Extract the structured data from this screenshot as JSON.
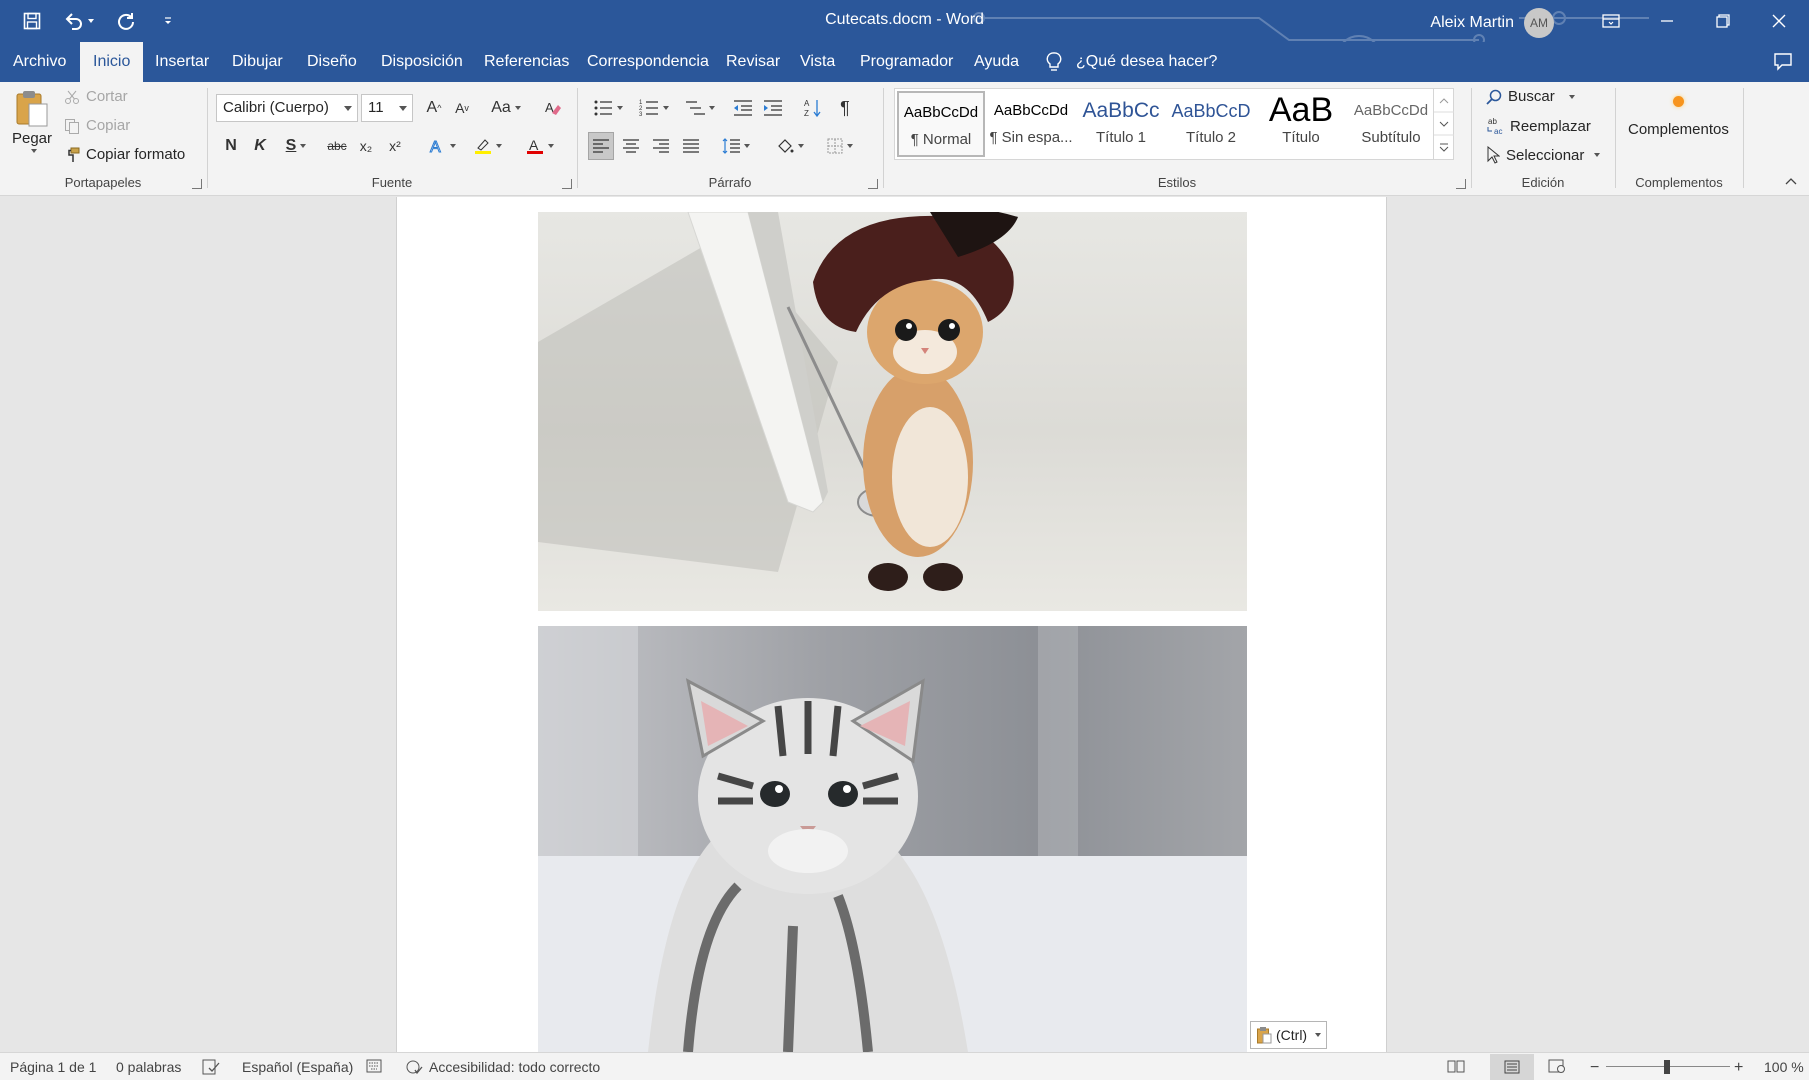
{
  "titlebar": {
    "document_title": "Cutecats.docm  -  Word",
    "user_name": "Aleix Martin",
    "user_initials": "AM"
  },
  "menu": {
    "tabs": [
      "Archivo",
      "Inicio",
      "Insertar",
      "Dibujar",
      "Diseño",
      "Disposición",
      "Referencias",
      "Correspondencia",
      "Revisar",
      "Vista",
      "Programador",
      "Ayuda"
    ],
    "active_tab": "Inicio",
    "tell_me": "¿Qué desea hacer?"
  },
  "ribbon": {
    "clipboard": {
      "paste": "Pegar",
      "cut": "Cortar",
      "copy": "Copiar",
      "format_painter": "Copiar formato",
      "group_name": "Portapapeles"
    },
    "font": {
      "font_name": "Calibri (Cuerpo)",
      "font_size": "11",
      "change_case": "Aa",
      "bold": "N",
      "italic": "K",
      "underline": "S",
      "strikethrough": "abc",
      "subscript": "x₂",
      "superscript": "x²",
      "grow": "A",
      "shrink": "A",
      "group_name": "Fuente"
    },
    "paragraph": {
      "group_name": "Párrafo",
      "show_marks": "¶"
    },
    "styles": {
      "items": [
        {
          "preview": "AaBbCcDd",
          "name": "¶ Normal"
        },
        {
          "preview": "AaBbCcDd",
          "name": "¶ Sin espa..."
        },
        {
          "preview": "AaBbCc",
          "name": "Título 1"
        },
        {
          "preview": "AaBbCcD",
          "name": "Título 2"
        },
        {
          "preview": "AaB",
          "name": "Título"
        },
        {
          "preview": "AaBbCcDd",
          "name": "Subtítulo"
        }
      ],
      "group_name": "Estilos"
    },
    "editing": {
      "find": "Buscar",
      "replace": "Reemplazar",
      "select": "Seleccionar",
      "group_name": "Edición"
    },
    "addins": {
      "button": "Complementos",
      "group_name": "Complementos"
    }
  },
  "document": {
    "paste_options": "(Ctrl)"
  },
  "statusbar": {
    "page": "Página 1 de 1",
    "words": "0 palabras",
    "language": "Español (España)",
    "accessibility": "Accesibilidad: todo correcto",
    "zoom": "100 %"
  },
  "colors": {
    "brand": "#2b579a",
    "ribbon_bg": "#f3f3f3",
    "addin_dot": "#f7941d"
  }
}
